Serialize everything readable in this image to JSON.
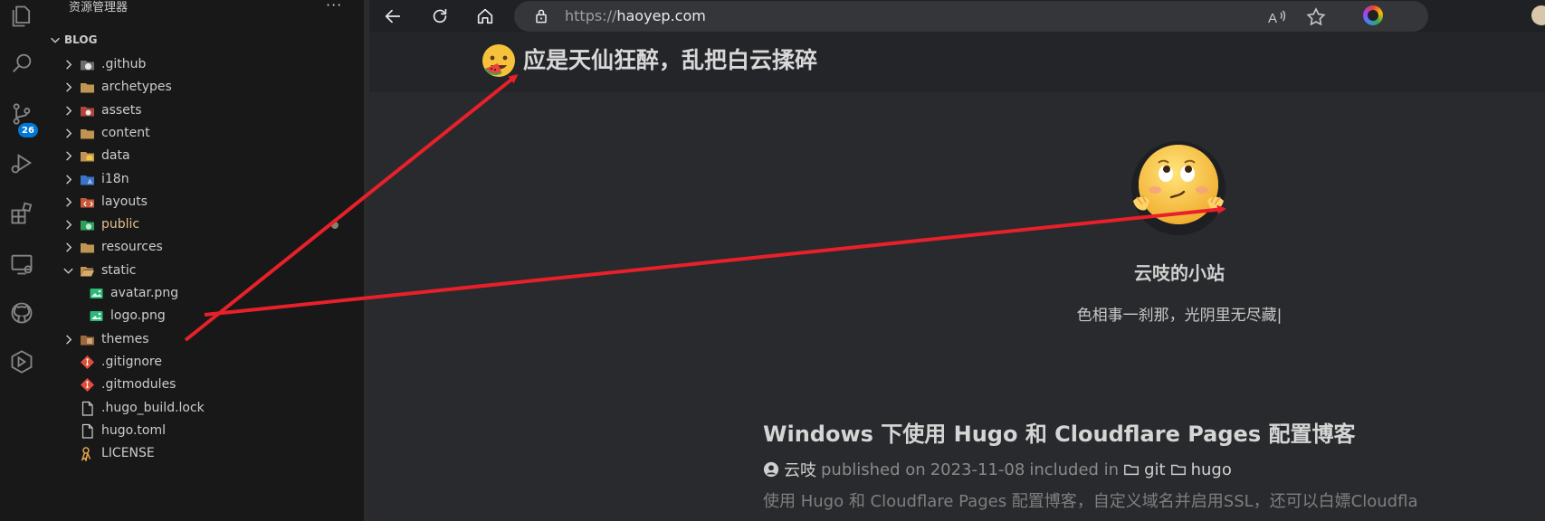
{
  "explorer": {
    "title": "资源管理器",
    "more": "···",
    "section": "BLOG",
    "items": [
      {
        "label": ".github",
        "kind": "folder",
        "icon": "github-folder-icon",
        "expanded": false
      },
      {
        "label": "archetypes",
        "kind": "folder",
        "icon": "folder-icon",
        "expanded": false
      },
      {
        "label": "assets",
        "kind": "folder",
        "icon": "assets-folder-icon",
        "expanded": false
      },
      {
        "label": "content",
        "kind": "folder",
        "icon": "folder-icon",
        "expanded": false
      },
      {
        "label": "data",
        "kind": "folder",
        "icon": "data-folder-icon",
        "expanded": false
      },
      {
        "label": "i18n",
        "kind": "folder",
        "icon": "i18n-folder-icon",
        "expanded": false
      },
      {
        "label": "layouts",
        "kind": "folder",
        "icon": "layouts-folder-icon",
        "expanded": false
      },
      {
        "label": "public",
        "kind": "folder",
        "icon": "public-folder-icon",
        "expanded": false,
        "modified": true
      },
      {
        "label": "resources",
        "kind": "folder",
        "icon": "folder-icon",
        "expanded": false
      },
      {
        "label": "static",
        "kind": "folder",
        "icon": "open-folder-icon",
        "expanded": true
      },
      {
        "label": "avatar.png",
        "kind": "image",
        "icon": "image-file-icon"
      },
      {
        "label": "logo.png",
        "kind": "image",
        "icon": "image-file-icon"
      },
      {
        "label": "themes",
        "kind": "folder",
        "icon": "themes-folder-icon",
        "expanded": false
      },
      {
        "label": ".gitignore",
        "kind": "git",
        "icon": "git-file-icon"
      },
      {
        "label": ".gitmodules",
        "kind": "git",
        "icon": "git-file-icon"
      },
      {
        "label": ".hugo_build.lock",
        "kind": "file",
        "icon": "file-icon"
      },
      {
        "label": "hugo.toml",
        "kind": "file",
        "icon": "file-icon"
      },
      {
        "label": "LICENSE",
        "kind": "license",
        "icon": "license-file-icon"
      }
    ]
  },
  "activity_bar": {
    "icons": [
      "files-icon",
      "search-icon",
      "source-control-icon",
      "run-debug-icon",
      "extensions-icon",
      "remote-explorer-icon",
      "github-icon",
      "hugo-icon"
    ],
    "source_control_badge": "26"
  },
  "browser": {
    "url_scheme": "https://",
    "url_host": "haoyep.com",
    "toolbar_icons": [
      "back-icon",
      "refresh-icon",
      "home-icon"
    ],
    "omnibox_icons": [
      "read-aloud-icon",
      "favorite-star-icon"
    ],
    "colors": {
      "toolbar": "#202124",
      "omnibox": "#35363a",
      "page_bg": "#292a2d"
    }
  },
  "site": {
    "title": "应是天仙狂醉，乱把白云揉碎",
    "profile_name": "云吱的小站",
    "profile_subtitle": "色相事一刹那，光阴里无尽藏|",
    "post": {
      "title": "Windows 下使用 Hugo 和 Cloudflare Pages 配置博客",
      "author": "云吱",
      "published_prefix": "published on",
      "date": "2023-11-08",
      "included_in": "included in",
      "categories": [
        "git",
        "hugo"
      ],
      "summary": "使用 Hugo 和 Cloudflare Pages 配置博客，自定义域名并启用SSL，还可以白嫖Cloudfla"
    }
  },
  "annotations": {
    "arrow_color": "#e8202a"
  }
}
